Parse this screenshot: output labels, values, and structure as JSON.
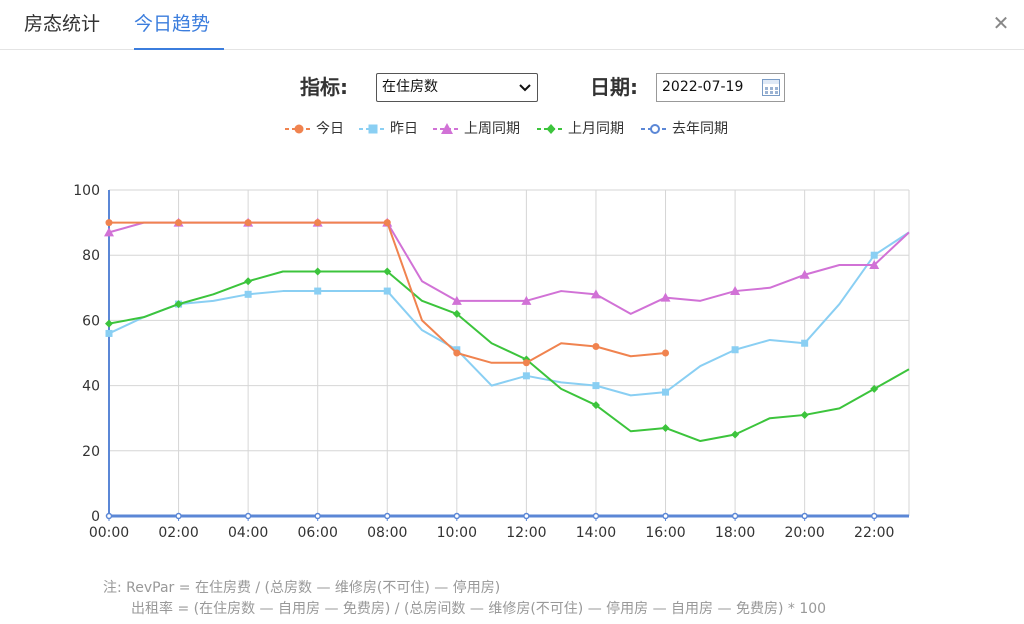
{
  "tabs": [
    {
      "label": "房态统计",
      "active": false
    },
    {
      "label": "今日趋势",
      "active": true
    }
  ],
  "close_icon": "close-icon",
  "filters": {
    "indicator_label": "指标:",
    "indicator_value": "在住房数",
    "date_label": "日期:",
    "date_value": "2022-07-19"
  },
  "colors": {
    "accent": "#3b7ddd",
    "today": "#f0834f",
    "yesterday": "#8acff3",
    "last_week": "#d172d6",
    "last_month": "#3cc43c",
    "last_year": "#5b87d6"
  },
  "chart_data": {
    "type": "line",
    "title": "",
    "xlabel": "",
    "ylabel": "",
    "ylim": [
      0,
      100
    ],
    "yticks": [
      0,
      20,
      40,
      60,
      80,
      100
    ],
    "grid": true,
    "legend_position": "top",
    "categories": [
      "00:00",
      "01:00",
      "02:00",
      "03:00",
      "04:00",
      "05:00",
      "06:00",
      "07:00",
      "08:00",
      "09:00",
      "10:00",
      "11:00",
      "12:00",
      "13:00",
      "14:00",
      "15:00",
      "16:00",
      "17:00",
      "18:00",
      "19:00",
      "20:00",
      "21:00",
      "22:00",
      "23:00"
    ],
    "tick_labels": [
      "00:00",
      "02:00",
      "04:00",
      "06:00",
      "08:00",
      "10:00",
      "12:00",
      "14:00",
      "16:00",
      "18:00",
      "20:00",
      "22:00"
    ],
    "series": [
      {
        "name": "今日",
        "marker": "circle",
        "values": [
          90,
          90,
          90,
          90,
          90,
          90,
          90,
          90,
          90,
          60,
          50,
          47,
          47,
          53,
          52,
          49,
          50,
          null,
          null,
          null,
          null,
          null,
          null,
          null
        ]
      },
      {
        "name": "昨日",
        "marker": "square",
        "values": [
          56,
          61,
          65,
          66,
          68,
          69,
          69,
          69,
          69,
          57,
          51,
          40,
          43,
          41,
          40,
          37,
          38,
          46,
          51,
          54,
          53,
          65,
          80,
          87
        ]
      },
      {
        "name": "上周同期",
        "marker": "triangle",
        "values": [
          87,
          90,
          90,
          90,
          90,
          90,
          90,
          90,
          90,
          72,
          66,
          66,
          66,
          69,
          68,
          62,
          67,
          66,
          69,
          70,
          74,
          77,
          77,
          87
        ]
      },
      {
        "name": "上月同期",
        "marker": "diamond",
        "values": [
          59,
          61,
          65,
          68,
          72,
          75,
          75,
          75,
          75,
          66,
          62,
          53,
          48,
          39,
          34,
          26,
          27,
          23,
          25,
          30,
          31,
          33,
          39,
          45
        ]
      },
      {
        "name": "去年同期",
        "marker": "hollow-circle",
        "values": [
          0,
          0,
          0,
          0,
          0,
          0,
          0,
          0,
          0,
          0,
          0,
          0,
          0,
          0,
          0,
          0,
          0,
          0,
          0,
          0,
          0,
          0,
          0,
          0
        ]
      }
    ]
  },
  "notes": {
    "line1": "注:  RevPar = 在住房费 / (总房数 — 维修房(不可住)  — 停用房)",
    "line2": "出租率 = (在住房数 — 自用房 — 免费房) / (总房间数 — 维修房(不可住)  — 停用房 — 自用房 — 免费房) * 100"
  }
}
